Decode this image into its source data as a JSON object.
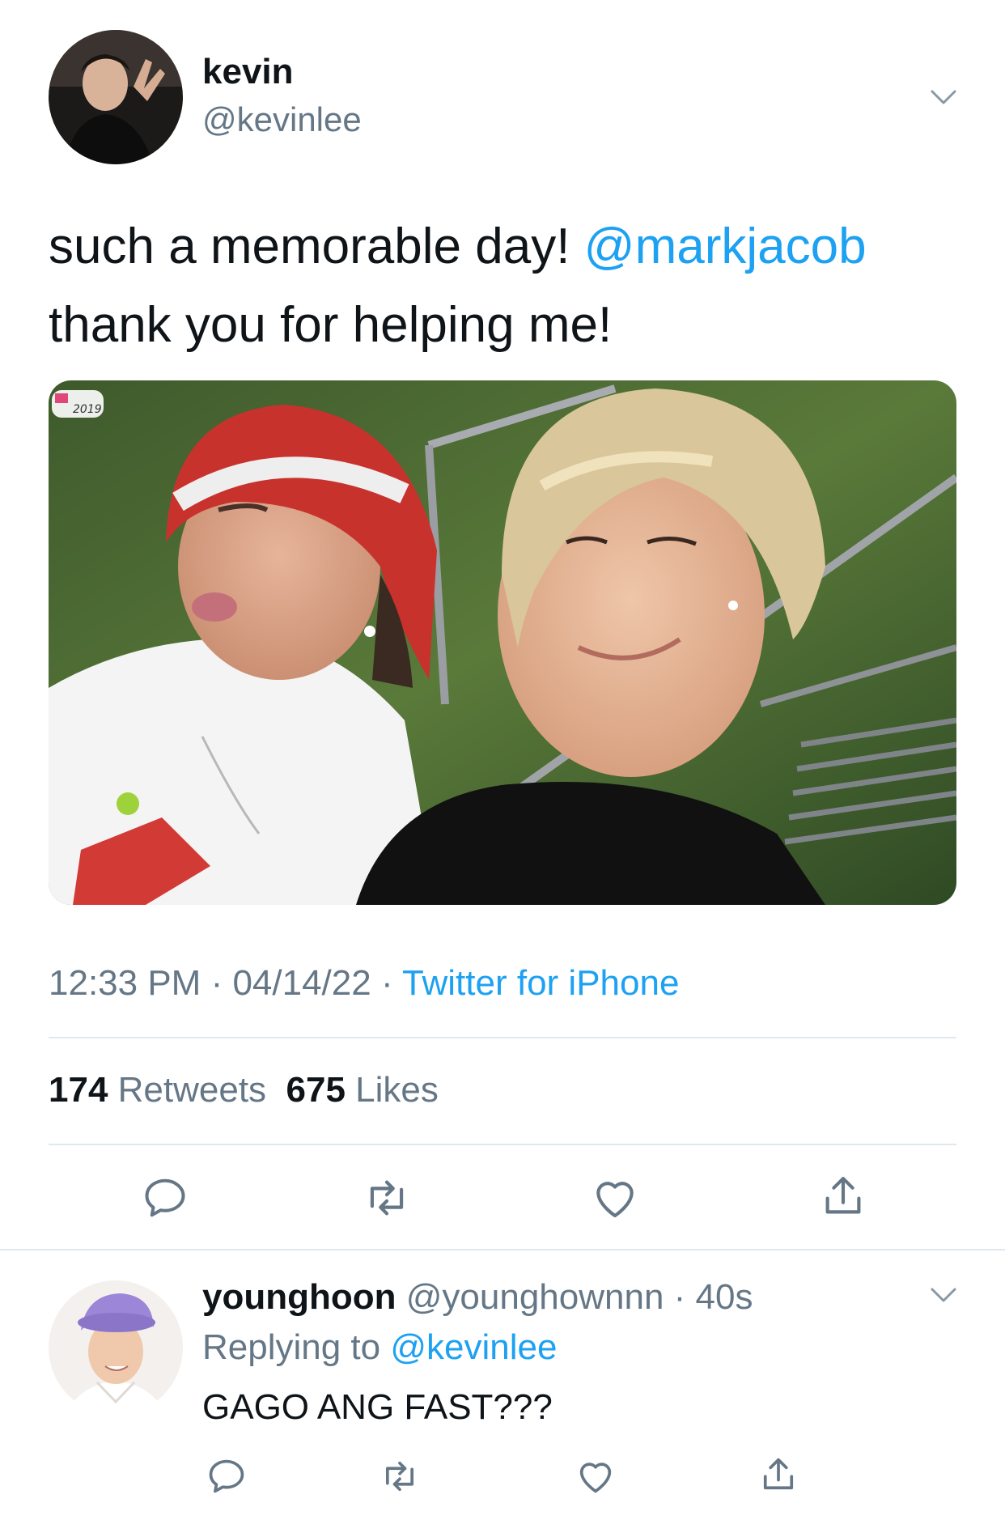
{
  "tweet": {
    "author_name": "kevin",
    "author_handle": "@kevinlee",
    "text_part1": "such a memorable day! ",
    "text_mention": "@markjacob",
    "text_part2": "thank you for helping me!",
    "time": "12:33 PM",
    "date": "04/14/22",
    "separator": " · ",
    "source": "Twitter for iPhone",
    "photo_badge_text": "2019",
    "retweets_count": "174",
    "retweets_label": " Retweets",
    "likes_count": "675",
    "likes_label": " Likes"
  },
  "reply": {
    "author_name": "younghoon",
    "author_handle": "@younghownnn",
    "dot": " · ",
    "age": "40s",
    "replying_prefix": "Replying to ",
    "replying_to": "@kevinlee",
    "text": "GAGO ANG FAST???"
  },
  "icons": {
    "reply": "reply-icon",
    "retweet": "retweet-icon",
    "like": "heart-icon",
    "share": "share-icon",
    "more": "chevron-down-icon"
  },
  "colors": {
    "accent": "#1da1f2",
    "text_primary": "#0f1419",
    "text_secondary": "#657786",
    "divider": "#e1e8ed"
  }
}
